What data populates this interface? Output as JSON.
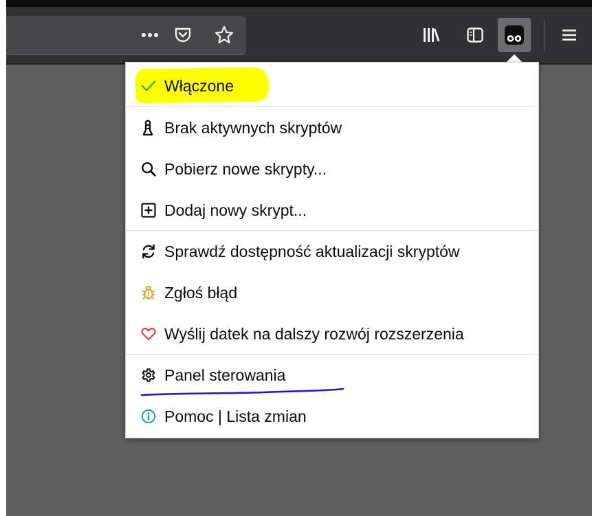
{
  "toolbar": {
    "more_icon": "more-icon",
    "pocket_icon": "pocket-icon",
    "bookmark_icon": "star-icon",
    "library_icon": "library-icon",
    "sidebar_icon": "sidebar-icon",
    "extension_icon": "tampermonkey-icon",
    "menu_icon": "hamburger-icon"
  },
  "menu": {
    "items": [
      {
        "label": "Włączone",
        "icon": "check-icon",
        "color": "#2db52d"
      },
      {
        "label": "Brak aktywnych skryptów",
        "icon": "script-icon"
      },
      {
        "label": "Pobierz nowe skrypty...",
        "icon": "search-icon"
      },
      {
        "label": "Dodaj nowy skrypt...",
        "icon": "plus-box-icon"
      },
      {
        "label": "Sprawdź dostępność aktualizacji skryptów",
        "icon": "refresh-icon"
      },
      {
        "label": "Zgłoś błąd",
        "icon": "bug-icon",
        "color": "#d4a017"
      },
      {
        "label": "Wyślij datek na dalszy rozwój rozszerzenia",
        "icon": "heart-icon",
        "color": "#e0362c"
      },
      {
        "label": "Panel sterowania",
        "icon": "gear-icon"
      },
      {
        "label": "Pomoc | Lista zmian",
        "icon": "info-icon",
        "color": "#1b9ad6"
      }
    ]
  },
  "annotations": {
    "highlight_color": "#ffff00",
    "underline_color": "#1a1ad6"
  }
}
